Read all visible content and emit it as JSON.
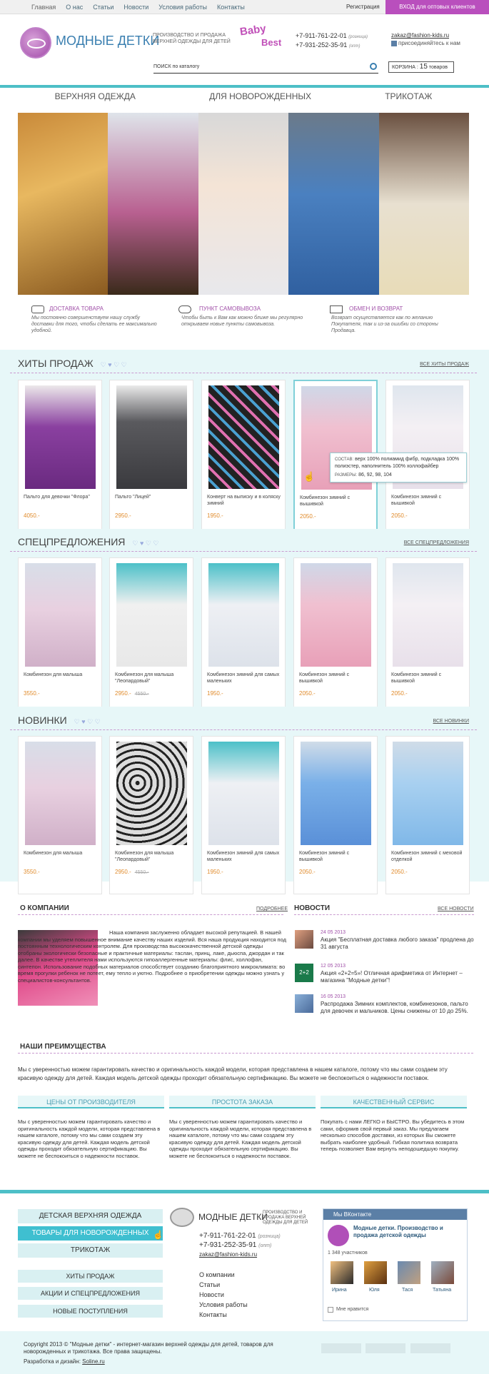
{
  "topbar": {
    "nav": [
      "Главная",
      "О нас",
      "Статьи",
      "Новости",
      "Условия работы",
      "Контакты"
    ],
    "register": "Регистрация",
    "wholesale": "ВХОД для оптовых клиентов"
  },
  "header": {
    "logo": "МОДНЫЕ ДЕТКИ",
    "slogan": "ПРОИЗВОДСТВО И ПРОДАЖА ВЕРХНЕЙ ОДЕЖДЫ ДЛЯ ДЕТЕЙ",
    "brand1": "Baby",
    "brand2": "Best",
    "phone1": "+7-911-761-22-01",
    "phone1_note": "(розница)",
    "phone2": "+7-931-252-35-91",
    "phone2_note": "(опт)",
    "email": "zakaz@fashion-kids.ru",
    "vk": "присоединяйтесь к нам",
    "search": "ПОИСК по каталогу",
    "cart_label": "КОРЗИНА :",
    "cart_count": "15",
    "cart_unit": "товаров"
  },
  "categories": [
    "ВЕРХНЯЯ ОДЕЖДА",
    "ДЛЯ НОВОРОЖДЕННЫХ",
    "ТРИКОТАЖ"
  ],
  "services": [
    {
      "title": "ДОСТАВКА ТОВАРА",
      "text": "Мы постоянно совершенствуем нашу службу доставки для того, чтобы сделать ее максимально удобной."
    },
    {
      "title": "ПУНКТ САМОВЫВОЗА",
      "text": "Чтобы быть к Вам как можно ближе мы регулярно открываем новые пункты самовывоза."
    },
    {
      "title": "ОБМЕН И ВОЗВРАТ",
      "text": "Возврат осуществляется как по желанию Покупателя, так и из-за ошибки со стороны Продавца."
    }
  ],
  "hits": {
    "title": "ХИТЫ ПРОДАЖ",
    "all": "ВСЕ ХИТЫ ПРОДАЖ",
    "items": [
      {
        "name": "Пальто для девочки \"Флора\"",
        "price": "4050.-"
      },
      {
        "name": "Пальто \"Лицей\"",
        "price": "2950.-"
      },
      {
        "name": "Конверт на выписку и в коляску зимний",
        "price": "1950.-"
      },
      {
        "name": "Комбинезон зимний с вышивкой",
        "price": "2050.-"
      },
      {
        "name": "Комбинезон зимний с вышивкой",
        "price": "2050.-"
      }
    ]
  },
  "tooltip": {
    "k1": "СОСТАВ:",
    "v1": "верх 100% полиамид фибр, подкладка 100% полиэстер, наполнитель 100% холлофайбер",
    "k2": "РАЗМЕРЫ:",
    "v2": "86, 92, 98, 104"
  },
  "special": {
    "title": "СПЕЦПРЕДЛОЖЕНИЯ",
    "all": "ВСЕ СПЕЦПРЕДЛОЖЕНИЯ",
    "items": [
      {
        "name": "Комбинезон для малыша",
        "price": "3550.-",
        "old": ""
      },
      {
        "name": "Комбинезон для малыша \"Леопардовый\"",
        "price": "2950.-",
        "old": "4550.-"
      },
      {
        "name": "Комбинезон зимний для самых маленьких",
        "price": "1950.-",
        "old": ""
      },
      {
        "name": "Комбинезон зимний с вышивкой",
        "price": "2050.-",
        "old": ""
      },
      {
        "name": "Комбинезон зимний с вышивкой",
        "price": "2050.-",
        "old": ""
      }
    ]
  },
  "new": {
    "title": "НОВИНКИ",
    "all": "ВСЕ НОВИНКИ",
    "items": [
      {
        "name": "Комбинезон для малыша",
        "price": "3550.-",
        "old": ""
      },
      {
        "name": "Комбинезон для малыша \"Леопардовый\"",
        "price": "2950.-",
        "old": "4550.-"
      },
      {
        "name": "Комбинезон зимний для самых маленьких",
        "price": "1950.-",
        "old": ""
      },
      {
        "name": "Комбинезон зимний с вышивкой",
        "price": "2050.-",
        "old": ""
      },
      {
        "name": "Комбинезон зимний с меховой отделкой",
        "price": "2050.-",
        "old": ""
      }
    ]
  },
  "company": {
    "title": "О КОМПАНИИ",
    "more": "ПОДРОБНЕЕ",
    "text1": "Наша компания заслуженно обладает высокой репутацией. В нашей компании мы уделяем повышенное внимание качеству наших изделий. Вся наша продукция находится под постоянным технологическим контролем. Для производства высококачественной детской одежды отобраны экологически безопасные и практичные материалы: таслан, принц, лаке, дьюспа, джордан и так далее. В качестве утеплителя нами используются гипоаллергенные материалы: флис, холлофан, синтепон. Использование подобных материалов способствует созданию благоприятного микроклимата: во время прогулки ребенок не потеет, ему тепло и уютно. Подробнее о приобретении одежды можно узнать у специалистов-консультантов."
  },
  "news": {
    "title": "НОВОСТИ",
    "all": "ВСЕ НОВОСТИ",
    "items": [
      {
        "date": "24 05 2013",
        "text": "Акция \"Бесплатная доставка любого заказа\" продлена до 31 августа"
      },
      {
        "date": "12 05 2013",
        "text": "Акция «2+2=5»! Отличная арифметика от Интернет – магазина \"Модные детки\"!"
      },
      {
        "date": "16 05 2013",
        "text": "Распродажа Зимних комплектов, комбинезонов, пальто для девочек и мальчиков. Цены снижены от 10 до 25%."
      }
    ]
  },
  "advantages": {
    "title": "НАШИ ПРЕИМУЩЕСТВА",
    "intro": "Мы с уверенностью можем гарантировать качество и оригинальность каждой модели, которая представлена в нашем каталоге, потому что мы сами создаем эту красивую одежду для детей. Каждая модель детской одежды проходит обязательную сертификацию. Вы можете не беспокоиться о надежности поставок.",
    "cols": [
      {
        "title": "ЦЕНЫ ОТ ПРОИЗВОДИТЕЛЯ",
        "text": "Мы с уверенностью можем гарантировать качество и оригинальность каждой модели, которая представлена в нашем каталоге, потому что мы сами создаем эту красивую одежду для детей. Каждая модель детской одежды проходит обязательную сертификацию. Вы можете не беспокоиться о надежности поставок."
      },
      {
        "title": "ПРОСТОТА ЗАКАЗА",
        "text": "Мы с уверенностью можем гарантировать качество и оригинальность каждой модели, которая представлена в нашем каталоге, потому что мы сами создаем эту красивую одежду для детей. Каждая модель детской одежды проходит обязательную сертификацию. Вы можете не беспокоиться о надежности поставок."
      },
      {
        "title": "КАЧЕСТВЕННЫЙ СЕРВИС",
        "text": "Покупать с нами ЛЕГКО и БЫСТРО. Вы убедитесь в этом сами, оформив свой первый заказ. Мы предлагаем несколько способов доставки, из которых Вы сможете выбрать наиболее удобный. Гибкая политика возврата теперь позволяет Вам вернуть неподошедшую покупку."
      }
    ]
  },
  "footer": {
    "menu1": [
      "ДЕТСКАЯ ВЕРХНЯЯ ОДЕЖДА",
      "ТОВАРЫ ДЛЯ НОВОРОЖДЕННЫХ",
      "ТРИКОТАЖ"
    ],
    "menu2": [
      "ХИТЫ ПРОДАЖ",
      "АКЦИИ И СПЕЦПРЕДЛОЖЕНИЯ",
      "НОВЫЕ ПОСТУПЛЕНИЯ"
    ],
    "links": [
      "О компании",
      "Статьи",
      "Новости",
      "Условия работы",
      "Контакты"
    ],
    "copyright": "Copyright 2013 © \"Модные детки\" - интернет-магазин верхней одежды для детей, товаров для новорожденных и трикотажа. Все права защищены.",
    "design_label": "Разработка и дизайн:",
    "design": "Soline.ru"
  },
  "vk": {
    "header": "Мы ВКонтакте",
    "group": "Модные детки. Производство и продажа детской одежды",
    "members": "1 348 участников",
    "people": [
      "Ирина",
      "Юля",
      "Тася",
      "Татьяна"
    ],
    "like": "Мне нравится"
  }
}
